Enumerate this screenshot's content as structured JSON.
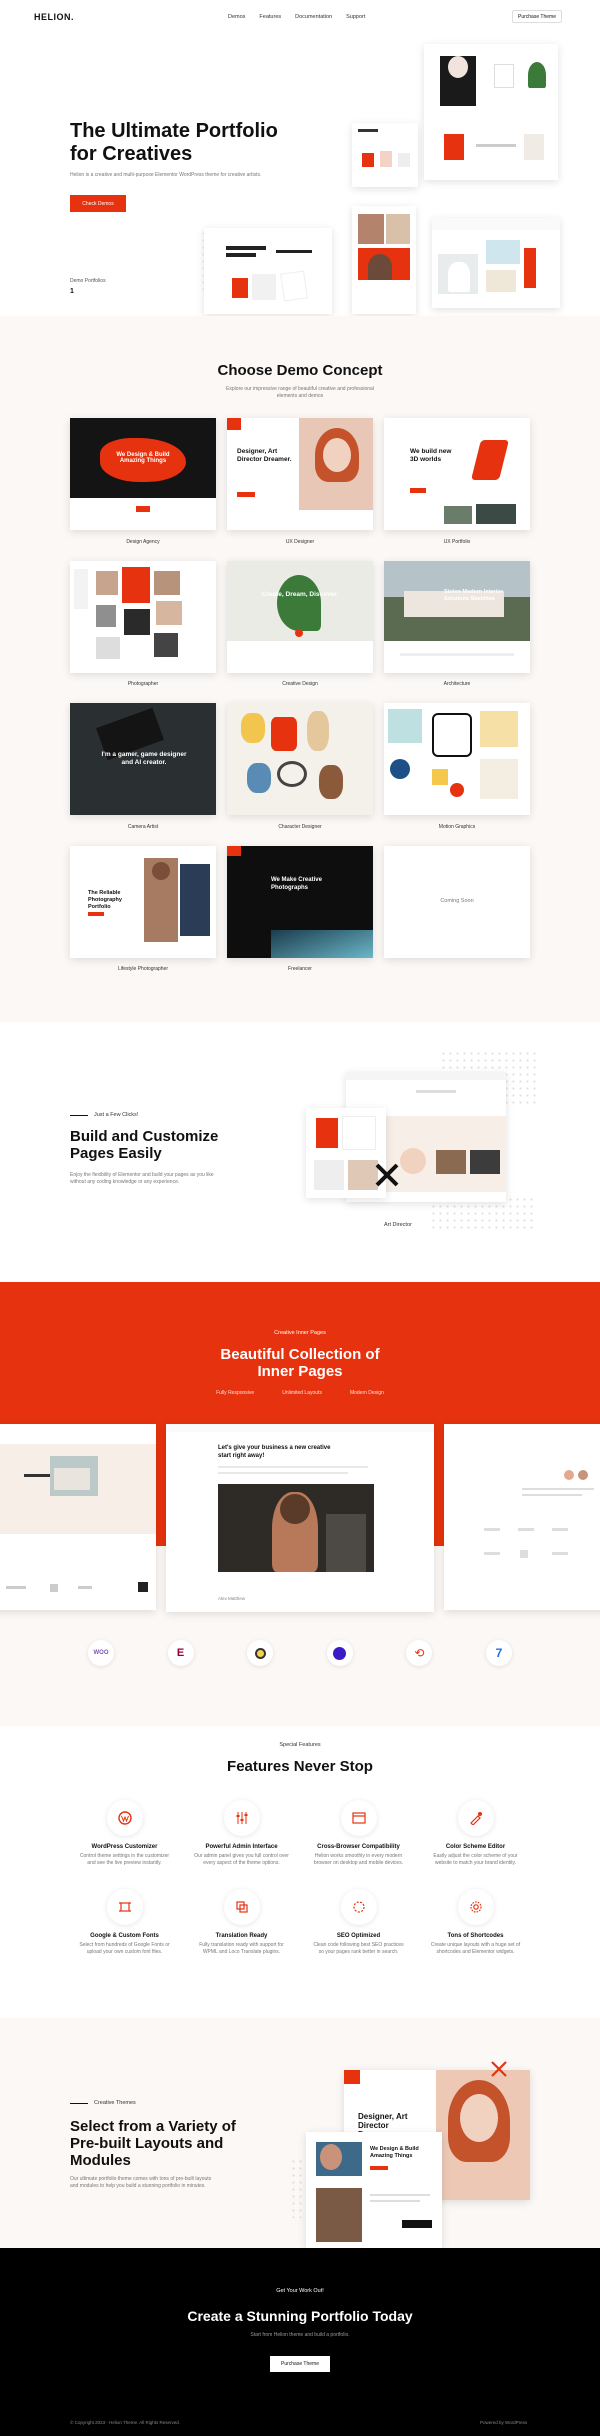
{
  "brand": {
    "logo": "HELION.",
    "accent": "#e6320e"
  },
  "nav": {
    "items": [
      "Demos",
      "Features",
      "Documentation",
      "Support"
    ],
    "purchase": "Purchase Theme"
  },
  "hero": {
    "title_1": "The Ultimate Portfolio",
    "title_2": "for Creatives",
    "subtitle": "Helion is a creative and multi-purpose Elementor WordPress theme for creative artists.",
    "button": "Check Demos",
    "counter_label": "Demo Portfolios",
    "counter_value": "1"
  },
  "demos": {
    "title": "Choose Demo Concept",
    "subtitle_1": "Explore our impressive range of beautiful creative and professional",
    "subtitle_2": "elements and demos",
    "items": [
      {
        "label": "Design Agency",
        "headline": "We Design & Build Amazing Things"
      },
      {
        "label": "UX Designer",
        "headline": "Designer, Art Director Dreamer."
      },
      {
        "label": "UX Portfolio",
        "headline": "We build new 3D worlds"
      },
      {
        "label": "Photographer",
        "headline": ""
      },
      {
        "label": "Creative Design",
        "headline": "Create, Dream, Discover."
      },
      {
        "label": "Architecture",
        "headline": "Stolen Modern Interior Solutions Sketches"
      },
      {
        "label": "Camera Artist",
        "headline": "I'm a gamer, game designer and AI creator."
      },
      {
        "label": "Character Designer",
        "headline": ""
      },
      {
        "label": "Motion Graphics",
        "headline": ""
      },
      {
        "label": "Lifestyle Photographer",
        "headline": "The Reliable Photography Portfolio"
      },
      {
        "label": "Freelancer",
        "headline": "We Make Creative Photographs"
      },
      {
        "label": "",
        "headline": "Coming Soon"
      }
    ]
  },
  "customize": {
    "eyebrow": "Just a Few Clicks!",
    "title_1": "Build and Customize",
    "title_2": "Pages Easily",
    "text_1": "Enjoy the flexibility of Elementor and build your pages as you like",
    "text_2": "without any coding knowledge or any experience.",
    "preview_label": "Art Director"
  },
  "inner": {
    "eyebrow": "Creative Inner Pages",
    "title_1": "Beautiful Collection of",
    "title_2": "Inner Pages",
    "features": [
      "Fully Responsive",
      "Unlimited Layouts",
      "Modern Design"
    ],
    "center_headline": "Let's give your business a new creative start right away!",
    "center_caption": "Alex Matthew"
  },
  "partners": [
    "WOO",
    "Elementor",
    "Mailchimp",
    "Slider Revolution",
    "Updater",
    "WPML"
  ],
  "features": {
    "eyebrow": "Special Features",
    "title": "Features Never Stop",
    "items": [
      {
        "icon": "wordpress-icon",
        "title": "WordPress Customizer",
        "text_1": "Control theme settings in the customizer",
        "text_2": "and see the live preview instantly."
      },
      {
        "icon": "sliders-icon",
        "title": "Powerful Admin Interface",
        "text_1": "Our admin panel gives you full control over",
        "text_2": "every aspect of the theme options."
      },
      {
        "icon": "browser-icon",
        "title": "Cross-Browser Compatibility",
        "text_1": "Helion works smoothly in every modern",
        "text_2": "browser on desktop and mobile devices."
      },
      {
        "icon": "palette-icon",
        "title": "Color Scheme Editor",
        "text_1": "Easily adjust the color scheme of your",
        "text_2": "website to match your brand identity."
      },
      {
        "icon": "crop-icon",
        "title": "Google & Custom Fonts",
        "text_1": "Select from hundreds of Google Fonts or",
        "text_2": "upload your own custom font files."
      },
      {
        "icon": "layers-icon",
        "title": "Translation Ready",
        "text_1": "Fully translation ready with support for",
        "text_2": "WPML and Loco Translate plugins."
      },
      {
        "icon": "sun-icon",
        "title": "SEO Optimized",
        "text_1": "Clean code following best SEO practices",
        "text_2": "so your pages rank better in search."
      },
      {
        "icon": "settings-icon",
        "title": "Tons of Shortcodes",
        "text_1": "Create unique layouts with a huge set of",
        "text_2": "shortcodes and Elementor widgets."
      }
    ]
  },
  "layouts": {
    "eyebrow": "Creative Themes",
    "title_1": "Select from a Variety of",
    "title_2": "Pre-built Layouts and",
    "title_3": "Modules",
    "text_1": "Our ultimate portfolio theme comes with tons of pre-built layouts",
    "text_2": "and modules to help you build a stunning portfolio in minutes.",
    "preview_1": "Designer, Art Director Dreamer.",
    "preview_2": "We Design & Build Amazing Things"
  },
  "cta": {
    "eyebrow": "Get Your Work Out!",
    "title": "Create a Stunning Portfolio Today",
    "subtitle": "Start from Helion theme and build a portfolio.",
    "button": "Purchase Theme"
  },
  "footer": {
    "copyright": "© Copyright 2023 - Helion Theme. All Rights Reserved.",
    "credit": "Powered by WordPress"
  }
}
